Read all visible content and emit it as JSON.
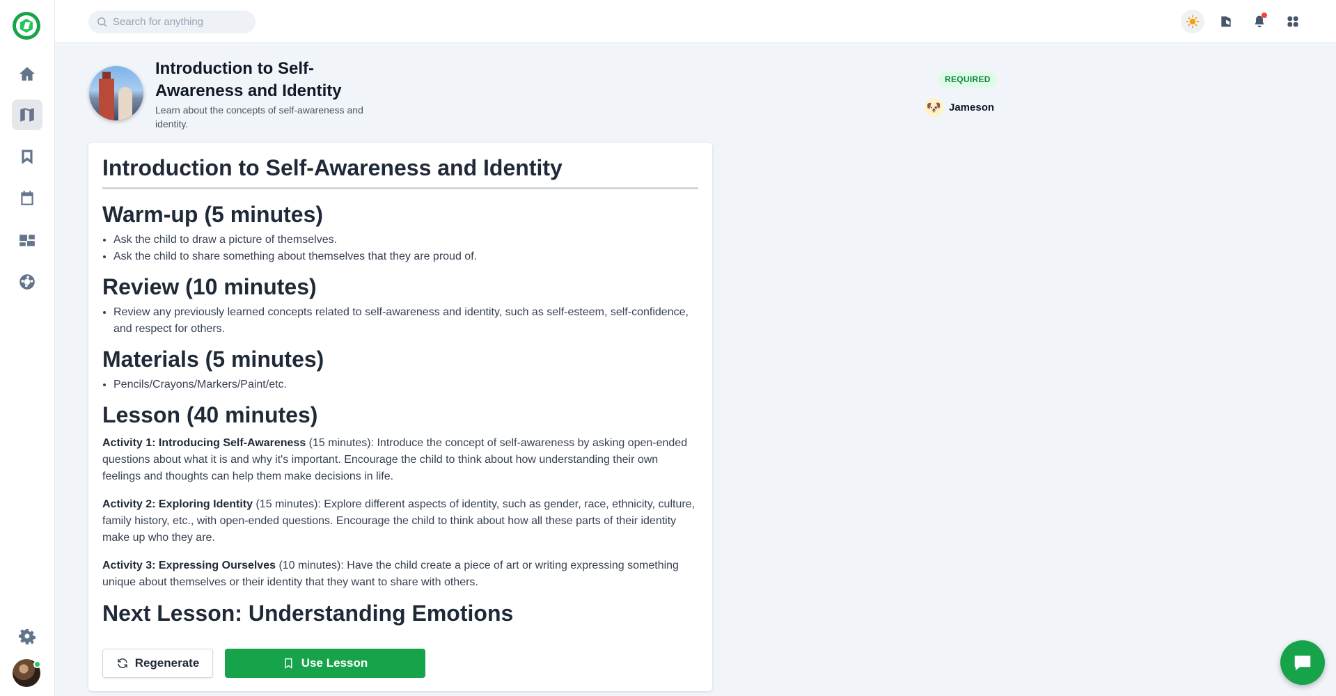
{
  "search": {
    "placeholder": "Search for anything"
  },
  "lesson": {
    "title": "Introduction to Self-Awareness and Identity",
    "subtitle": "Learn about the concepts of self-awareness and identity.",
    "badge": "REQUIRED",
    "assignee": "Jameson"
  },
  "content": {
    "heading": "Introduction to Self-Awareness and Identity",
    "warmup": {
      "title": "Warm-up (5 minutes)",
      "items": [
        "Ask the child to draw a picture of themselves.",
        "Ask the child to share something about themselves that they are proud of."
      ]
    },
    "review": {
      "title": "Review (10 minutes)",
      "items": [
        "Review any previously learned concepts related to self-awareness and identity, such as self-esteem, self-confidence, and respect for others."
      ]
    },
    "materials": {
      "title": "Materials (5 minutes)",
      "items": [
        "Pencils/Crayons/Markers/Paint/etc."
      ]
    },
    "lesson": {
      "title": "Lesson (40 minutes)",
      "activities": [
        {
          "name": "Activity 1: Introducing Self-Awareness",
          "text": " (15 minutes): Introduce the concept of self-awareness by asking open-ended questions about what it is and why it's important. Encourage the child to think about how understanding their own feelings and thoughts can help them make decisions in life."
        },
        {
          "name": "Activity 2: Exploring Identity",
          "text": " (15 minutes): Explore different aspects of identity, such as gender, race, ethnicity, culture, family history, etc., with open-ended questions. Encourage the child to think about how all these parts of their identity make up who they are."
        },
        {
          "name": "Activity 3: Expressing Ourselves",
          "text": " (10 minutes): Have the child create a piece of art or writing expressing something unique about themselves or their identity that they want to share with others."
        }
      ]
    },
    "next": "Next Lesson: Understanding Emotions"
  },
  "actions": {
    "regenerate": "Regenerate",
    "use": "Use Lesson"
  },
  "icons": {
    "sidebar": [
      "home-icon",
      "map-icon",
      "bookmark-icon",
      "calendar-icon",
      "dashboard-icon",
      "support-icon",
      "settings-icon"
    ],
    "topbar": [
      "sun-icon",
      "theme-icon",
      "bell-icon",
      "apps-icon"
    ],
    "chat": "chat-icon"
  },
  "colors": {
    "brand": "#16a34a",
    "badge_bg": "#dcfce7",
    "badge_text": "#15803d",
    "notification": "#ef4444"
  }
}
